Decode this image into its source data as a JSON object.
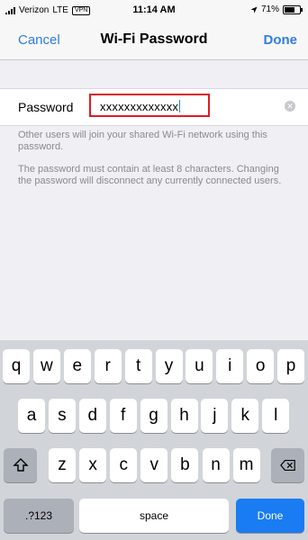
{
  "status_bar": {
    "carrier": "Verizon",
    "network": "LTE",
    "vpn": "VPN",
    "time": "11:14 AM",
    "battery_percent": "71%",
    "battery_level": 0.71
  },
  "nav": {
    "cancel_label": "Cancel",
    "title": "Wi-Fi Password",
    "done_label": "Done"
  },
  "password_row": {
    "label": "Password",
    "value": "xxxxxxxxxxxxx",
    "highlight_color": "#e11b22"
  },
  "footnotes": [
    "Other users will join your shared Wi-Fi network using this password.",
    "The password must contain at least 8 characters. Changing the password will disconnect any currently connected users."
  ],
  "keyboard": {
    "row1": [
      "q",
      "w",
      "e",
      "r",
      "t",
      "y",
      "u",
      "i",
      "o",
      "p"
    ],
    "row2": [
      "a",
      "s",
      "d",
      "f",
      "g",
      "h",
      "j",
      "k",
      "l"
    ],
    "row3": [
      "z",
      "x",
      "c",
      "v",
      "b",
      "n",
      "m"
    ],
    "shift_icon": "shift-arrow-icon",
    "backspace_icon": "backspace-icon",
    "numbers_label": ".?123",
    "space_label": "space",
    "done_label": "Done",
    "accent_color": "#1a7cf2"
  }
}
